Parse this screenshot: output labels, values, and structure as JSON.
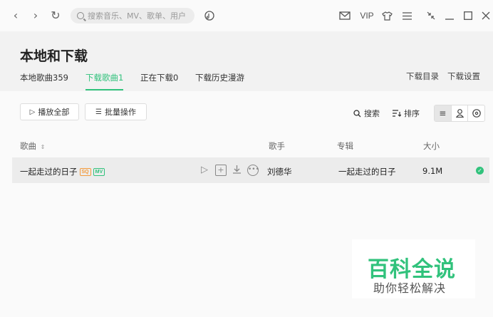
{
  "toolbar": {
    "back_icon": "‹",
    "forward_icon": "›",
    "refresh_icon": "↻",
    "search_placeholder": "搜索音乐、MV、歌单、用户",
    "vip_label": "VIP"
  },
  "header": {
    "title": "本地和下载",
    "tabs": [
      {
        "label": "本地歌曲359"
      },
      {
        "label": "下载歌曲1"
      },
      {
        "label": "正在下载0"
      },
      {
        "label": "下载历史漫游"
      }
    ],
    "links": {
      "download_dir": "下载目录",
      "download_settings": "下载设置"
    }
  },
  "actions": {
    "play_all": "播放全部",
    "batch": "批量操作",
    "search": "搜索",
    "sort": "排序"
  },
  "table": {
    "columns": {
      "song": "歌曲",
      "artist": "歌手",
      "album": "专辑",
      "size": "大小"
    },
    "rows": [
      {
        "song": "一起走过的日子",
        "badge_sq": "SQ",
        "badge_mv": "MV",
        "artist": "刘德华",
        "album": "一起走过的日子",
        "size": "9.1M"
      }
    ]
  },
  "watermark": {
    "title": "百科全说",
    "subtitle": "助你轻松解决"
  },
  "colors": {
    "accent": "#31c27c",
    "sq_badge": "#f39a3b"
  }
}
